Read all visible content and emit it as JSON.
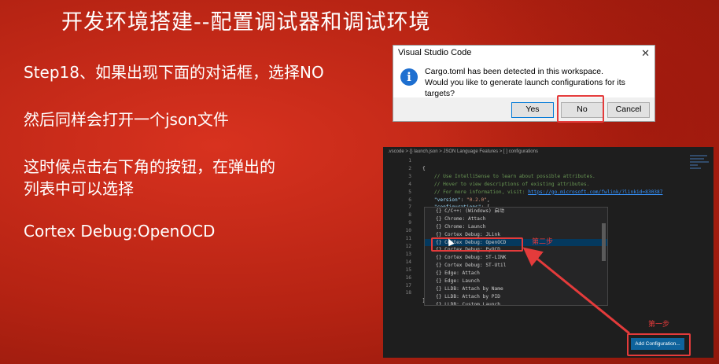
{
  "slide": {
    "title": "开发环境搭建--配置调试器和调试环境",
    "step_line": "Step18、如果出现下面的对话框，选择NO",
    "json_line": "然后同样会打开一个json文件",
    "click_line_1": "这时候点击右下角的按钮，在弹出的",
    "click_line_2": "列表中可以选择",
    "choice_line": "Cortex Debug:OpenOCD"
  },
  "dialog": {
    "title": "Visual Studio Code",
    "close_glyph": "✕",
    "icon_glyph": "i",
    "message_line1": "Cargo.toml has been detected in this workspace.",
    "message_line2": "Would you like to generate launch configurations for its targets?",
    "yes": "Yes",
    "no": "No",
    "cancel": "Cancel"
  },
  "editor": {
    "breadcrumb": ".vscode > {} launch.json > JSON Language Features > [ ] configurations",
    "line_numbers": [
      "1",
      "2",
      "3",
      "4",
      "5",
      "6",
      "7",
      "8",
      "9",
      "10",
      "11",
      "12",
      "13",
      "14",
      "15",
      "16",
      "17",
      "18"
    ],
    "code": {
      "l1": "{",
      "l2": "    // Use IntelliSense to learn about possible attributes.",
      "l3": "    // Hover to view descriptions of existing attributes.",
      "l4_prefix": "    // For more information, visit: ",
      "l4_link": "https://go.microsoft.com/fwlink/?linkid=830387",
      "l5_key": "    \"version\"",
      "l5_val": "\"0.2.0\"",
      "l6_key": "    \"configurations\"",
      "l6_rest": ": [",
      "l7": "        ",
      "l18": "}"
    },
    "suggestions": [
      "{} C/C++: (Windows) 启动",
      "{} Chrome: Attach",
      "{} Chrome: Launch",
      "{} Cortex Debug: JLink",
      "{} Cortex Debug: OpenOCD",
      "{} Cortex Debug: PyOCD",
      "{} Cortex Debug: ST-LINK",
      "{} Cortex Debug: ST-Util",
      "{} Edge: Attach",
      "{} Edge: Launch",
      "{} LLDB: Attach by Name",
      "{} LLDB: Attach by PID",
      "{} LLDB: Custom Launch"
    ],
    "selected_suggestion": "{} Cortex Debug: OpenOCD",
    "add_config_button": "Add Configuration..."
  },
  "annotations": {
    "step2": "第二步",
    "step1": "第一步"
  },
  "colors": {
    "background": "#b52313",
    "highlight_red": "#e43b3b",
    "editor_bg": "#1e1e1e",
    "button_blue": "#0e639c",
    "info_blue": "#1e6fd0"
  }
}
